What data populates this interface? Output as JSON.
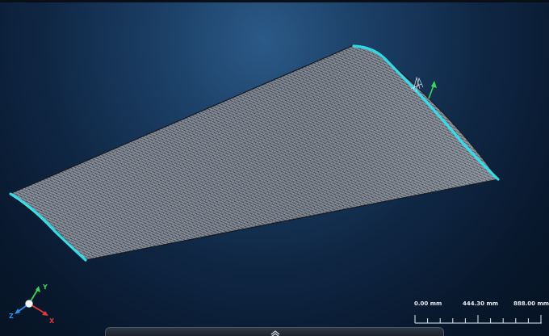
{
  "viewport": {
    "background_top": "#2b5a88",
    "background_bottom": "#061222",
    "mesh_fill": "#8f97a3",
    "mesh_line": "#2a3038",
    "edge_highlight": "#2fe1ee"
  },
  "triad": {
    "x_label": "X",
    "y_label": "Y",
    "z_label": "Z",
    "x_color": "#e0383b",
    "y_color": "#3fd25a",
    "z_color": "#2f8fe8"
  },
  "scale_bar": {
    "labels": [
      "0.00 mm",
      "444.30 mm",
      "888.00 mm"
    ]
  },
  "icons": {
    "manipulator": "move-arrow-icon",
    "panel_handle": "chevron-up-icon"
  }
}
